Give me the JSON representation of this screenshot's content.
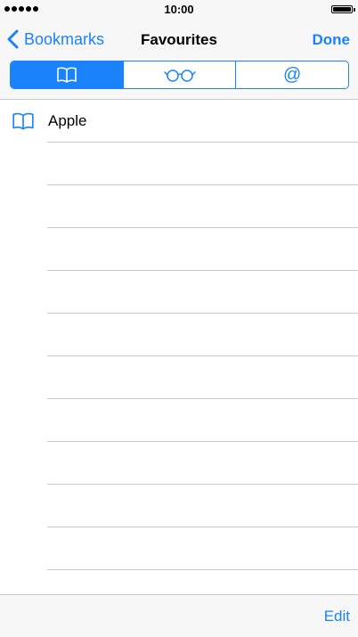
{
  "status_bar": {
    "time": "10:00"
  },
  "nav": {
    "back_label": "Bookmarks",
    "title": "Favourites",
    "done_label": "Done"
  },
  "segments": [
    {
      "icon": "book-icon",
      "selected": true
    },
    {
      "icon": "glasses-icon",
      "selected": false
    },
    {
      "icon": "at-sign-icon",
      "label": "@",
      "selected": false
    }
  ],
  "bookmarks": [
    {
      "icon": "book-icon",
      "label": "Apple"
    }
  ],
  "toolbar": {
    "edit_label": "Edit"
  },
  "colors": {
    "accent": "#1a82fb",
    "separator": "#c8c7cc",
    "bar": "#f7f7f7"
  }
}
